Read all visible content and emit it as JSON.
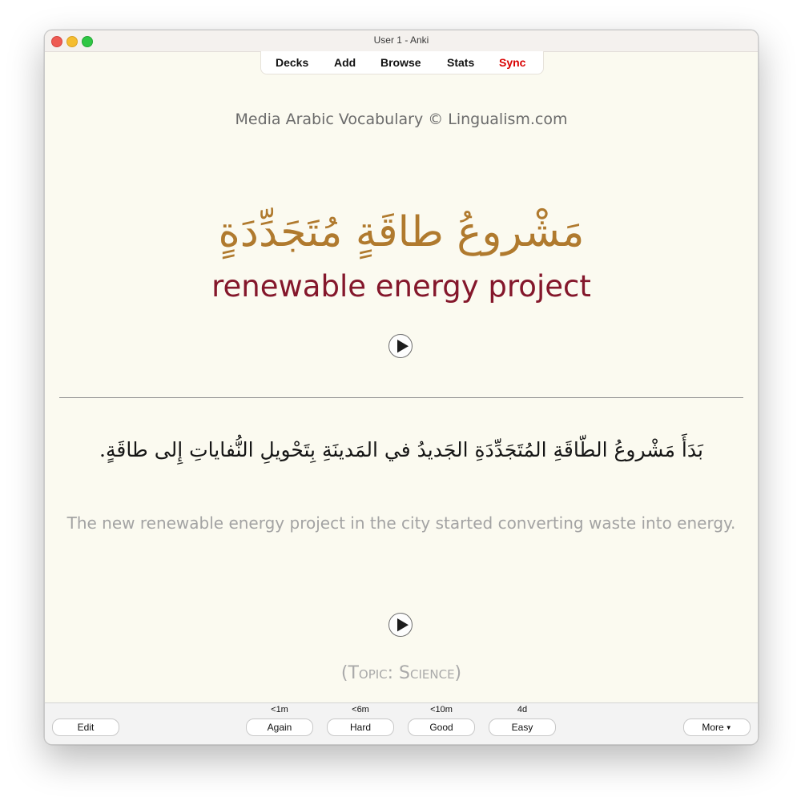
{
  "window": {
    "title": "User 1 - Anki"
  },
  "toolbar": {
    "decks": "Decks",
    "add": "Add",
    "browse": "Browse",
    "stats": "Stats",
    "sync": "Sync",
    "sync_color": "#d90000"
  },
  "card": {
    "deck_title": "Media Arabic Vocabulary © Lingualism.com",
    "arabic_word": "مَشْروعُ طاقَةٍ مُتَجَدِّدَةٍ",
    "english_word": "renewable energy project",
    "arabic_sentence": "بَدَأَ مَشْروعُ الطّاقَةِ المُتَجَدِّدَةِ الجَديدُ في المَدينَةِ بِتَحْويلِ النُّفاياتِ إِلى طاقَةٍ.",
    "english_sentence": "The new renewable energy project in the city started converting waste into energy.",
    "topic": "(Topic: Science)",
    "arabic_color": "#b07a2e",
    "english_color": "#84172b"
  },
  "bottom": {
    "edit": "Edit",
    "more": "More",
    "answers": [
      {
        "time": "<1m",
        "label": "Again"
      },
      {
        "time": "<6m",
        "label": "Hard"
      },
      {
        "time": "<10m",
        "label": "Good"
      },
      {
        "time": "4d",
        "label": "Easy"
      }
    ]
  },
  "icons": {
    "play": "play-icon",
    "more_caret": "caret-down-icon"
  }
}
